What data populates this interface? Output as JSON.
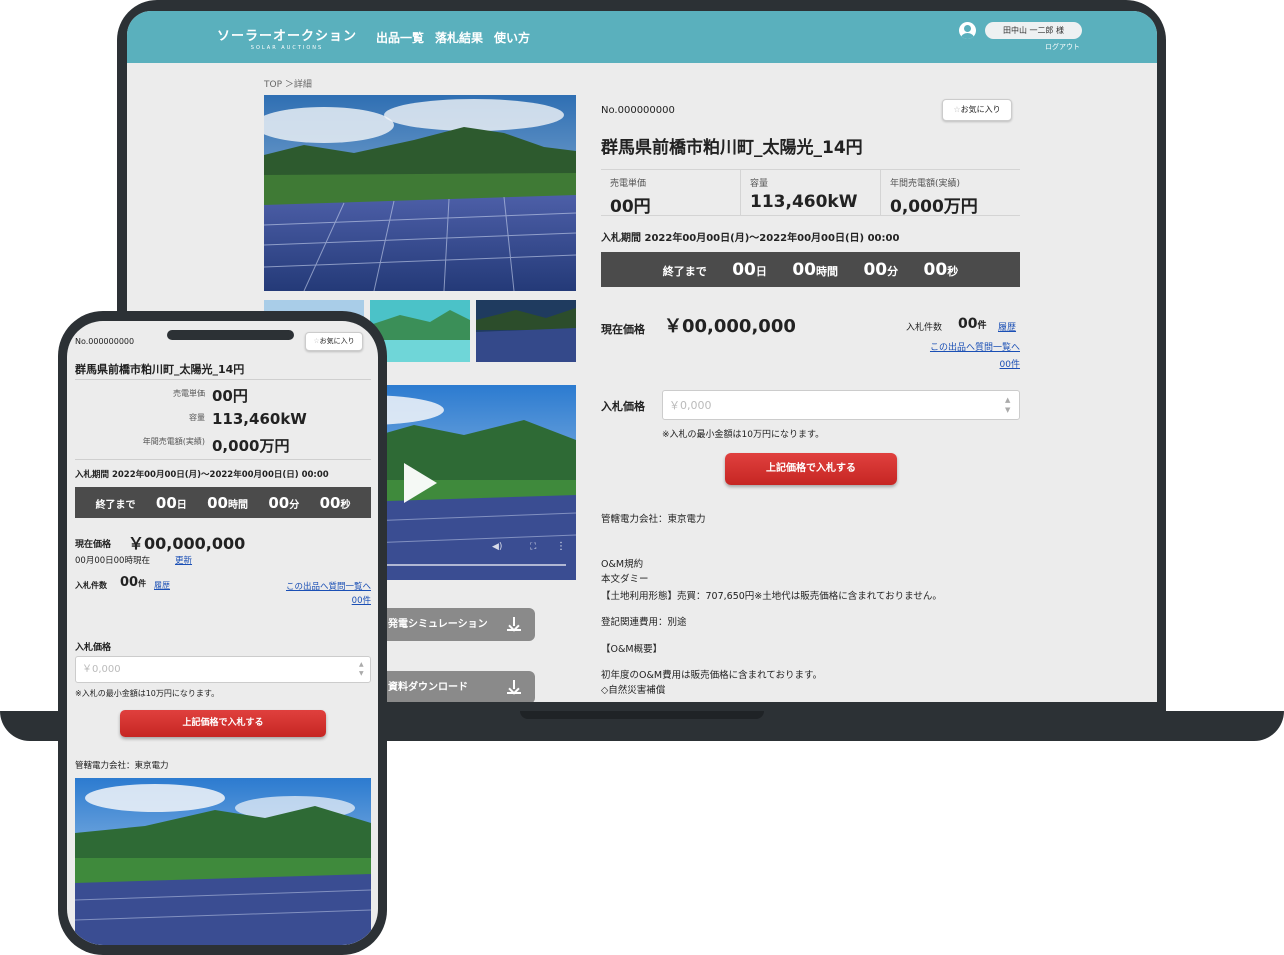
{
  "brand": {
    "name": "ソーラーオークション",
    "sub": "SOLAR AUCTIONS"
  },
  "nav": {
    "items": [
      "出品一覧",
      "落札結果",
      "使い方"
    ]
  },
  "user": {
    "name": "田中山 一二郎 様",
    "logout": "ログアウト"
  },
  "breadcrumb": "TOP ＞詳細",
  "item": {
    "number": "No.000000000",
    "favorite": "お気に入り",
    "title": "群馬県前橋市粕川町_太陽光_14円",
    "specs": [
      {
        "label": "売電単価",
        "value": "00円"
      },
      {
        "label": "容量",
        "value": "113,460kW"
      },
      {
        "label": "年間売電額(実績)",
        "value": "0,000万円"
      }
    ],
    "period": "入札期間 2022年00月00日(月)～2022年00月00日(日) 00:00",
    "timer": {
      "prefix": "終了まで",
      "days": "00",
      "days_unit": "日",
      "hours": "00",
      "hours_unit": "時間",
      "minutes": "00",
      "minutes_unit": "分",
      "seconds": "00",
      "seconds_unit": "秒"
    },
    "current_price_label": "現在価格",
    "current_price": "￥00,000,000",
    "bid_count_label": "入札件数",
    "bid_count": "00",
    "bid_count_unit": "件",
    "history_link": "履歴",
    "qa_link": "この出品へ質問一覧へ",
    "qa_count": "00件",
    "as_of": "00月00日00時現在",
    "refresh": "更新",
    "bid_price_label": "入札価格",
    "bid_placeholder": "￥0,000",
    "bid_note": "※入札の最小金額は10万円になります。",
    "bid_button": "上記価格で入札する",
    "downloads": [
      "発電シミュレーション",
      "資料ダウンロード"
    ],
    "description": [
      "管轄電力会社：東京電力",
      "O&M規約",
      "本文ダミー",
      "【土地利用形態】売買：707,650円※土地代は販売価格に含まれておりません。",
      "登記関連費用：別途",
      "【O&M概要】",
      "初年度のO&M費用は販売価格に含まれております。",
      "◇自然災害補償"
    ]
  },
  "colors": {
    "header": "#5ab0bd",
    "bid_button": "#d3302d",
    "timer_bg": "#4b4b4b",
    "link": "#1a4fb5",
    "device": "#2c3135"
  }
}
